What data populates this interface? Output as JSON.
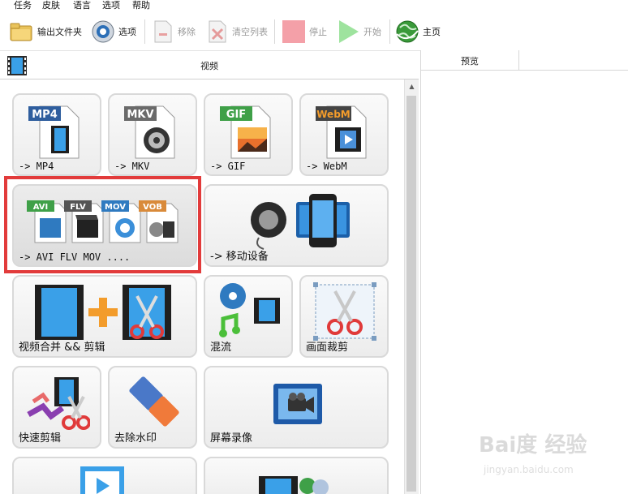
{
  "menu": [
    "任务",
    "皮肤",
    "语言",
    "选项",
    "帮助"
  ],
  "toolbar": {
    "output_folder": "输出文件夹",
    "options": "选项",
    "remove": "移除",
    "clear_list": "清空列表",
    "stop": "停止",
    "start": "开始",
    "home": "主页"
  },
  "panel": {
    "title": "视频"
  },
  "preview": {
    "title": "预览"
  },
  "tiles": {
    "mp4": {
      "label": "-> MP4",
      "badge": "MP4",
      "badge_color": "#2f5e9e"
    },
    "mkv": {
      "label": "-> MKV",
      "badge": "MKV",
      "badge_color": "#6a6a6a"
    },
    "gif": {
      "label": "-> GIF",
      "badge": "GIF",
      "badge_color": "#3fa048"
    },
    "webm": {
      "label": "-> WebM",
      "badge": "WebM",
      "badge_color": "#444444",
      "badge_text_color": "#f39c2b"
    },
    "multi": {
      "label": "-> AVI FLV MOV ....",
      "badges": [
        "AVI",
        "FLV",
        "MOV",
        "VOB"
      ],
      "badge_colors": [
        "#3fa048",
        "#555555",
        "#2f7ac0",
        "#d98a3a"
      ]
    },
    "mobile": {
      "label": "-> 移动设备"
    },
    "merge": {
      "label": "视频合并 && 剪辑"
    },
    "mux": {
      "label": "混流"
    },
    "crop": {
      "label": "画面裁剪"
    },
    "quick_cut": {
      "label": "快速剪辑"
    },
    "remove_watermark": {
      "label": "去除水印"
    },
    "screen_record": {
      "label": "屏幕录像"
    }
  },
  "watermark": {
    "main": "Bai度 经验",
    "sub": "jingyan.baidu.com"
  },
  "colors": {
    "selection": "#e23b3b",
    "accent_green": "#5fc05f"
  }
}
